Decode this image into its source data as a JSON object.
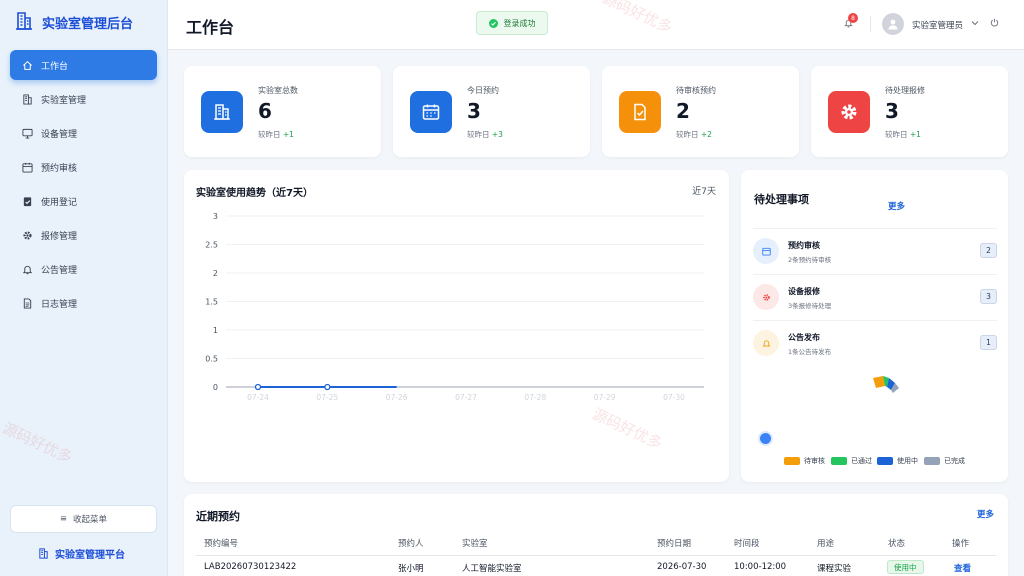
{
  "app": {
    "title": "实验室管理后台",
    "platform_label": "实验室管理平台",
    "collapse_label": "收起菜单"
  },
  "nav": [
    {
      "label": "工作台",
      "icon": "home-icon",
      "active": true
    },
    {
      "label": "实验室管理",
      "icon": "building-icon"
    },
    {
      "label": "设备管理",
      "icon": "monitor-icon"
    },
    {
      "label": "预约审核",
      "icon": "calendar-icon"
    },
    {
      "label": "使用登记",
      "icon": "clipboard-check-icon"
    },
    {
      "label": "报修管理",
      "icon": "gear-icon"
    },
    {
      "label": "公告管理",
      "icon": "bell-icon"
    },
    {
      "label": "日志管理",
      "icon": "document-icon"
    }
  ],
  "header": {
    "title": "工作台",
    "toast": "登录成功",
    "notification_count": "8",
    "user_name": "实验室管理员"
  },
  "stats": [
    {
      "label": "实验室总数",
      "value": "6",
      "compare_label": "较昨日",
      "delta": "+1",
      "color": "#1f6fe0",
      "icon": "building-icon"
    },
    {
      "label": "今日预约",
      "value": "3",
      "compare_label": "较昨日",
      "delta": "+3",
      "color": "#1f6fe0",
      "icon": "calendar-icon"
    },
    {
      "label": "待审核预约",
      "value": "2",
      "compare_label": "较昨日",
      "delta": "+2",
      "color": "#f5900b",
      "icon": "document-check-icon"
    },
    {
      "label": "待处理报修",
      "value": "3",
      "compare_label": "较昨日",
      "delta": "+1",
      "color": "#ef4444",
      "icon": "gear-icon"
    }
  ],
  "trend": {
    "title": "实验室使用趋势（近7天）",
    "range_label": "近7天"
  },
  "chart_data": {
    "type": "line",
    "categories": [
      "07-24",
      "07-25",
      "07-26",
      "07-27",
      "07-28",
      "07-29",
      "07-30"
    ],
    "series": [
      {
        "values": [
          0,
          0,
          0,
          null,
          null,
          null,
          null
        ]
      }
    ],
    "yticks": [
      "0",
      "0.5",
      "1",
      "1.5",
      "2",
      "2.5",
      "3"
    ],
    "ylim": [
      0,
      3
    ],
    "grid": true,
    "color": "#1d63d8"
  },
  "todo": {
    "title": "待处理事项",
    "more": "更多",
    "items": [
      {
        "name": "预约审核",
        "desc": "2条预约待审核",
        "count": "2",
        "icon": "calendar-icon",
        "color": "#3b82f6"
      },
      {
        "name": "设备报修",
        "desc": "3条报修待处理",
        "count": "3",
        "icon": "gear-icon",
        "color": "#ef4444"
      },
      {
        "name": "公告发布",
        "desc": "1条公告待发布",
        "count": "1",
        "icon": "bell-icon",
        "color": "#f59e0b"
      }
    ],
    "legend": [
      {
        "label": "待审核",
        "color": "#f59e0b"
      },
      {
        "label": "已通过",
        "color": "#22c55e"
      },
      {
        "label": "使用中",
        "color": "#1d63d8"
      },
      {
        "label": "已完成",
        "color": "#94a3b8"
      }
    ]
  },
  "recent": {
    "title": "近期预约",
    "more": "更多",
    "columns": [
      "预约编号",
      "预约人",
      "实验室",
      "预约日期",
      "时间段",
      "用途",
      "状态",
      "操作"
    ],
    "rows": [
      {
        "id": "LAB20260730123422",
        "person": "张小明",
        "lab": "人工智能实验室",
        "date": "2026-07-30",
        "slot": "10:00-12:00",
        "purpose": "课程实验",
        "status": "使用中",
        "action": "查看"
      }
    ]
  },
  "watermark": "源码好优多"
}
